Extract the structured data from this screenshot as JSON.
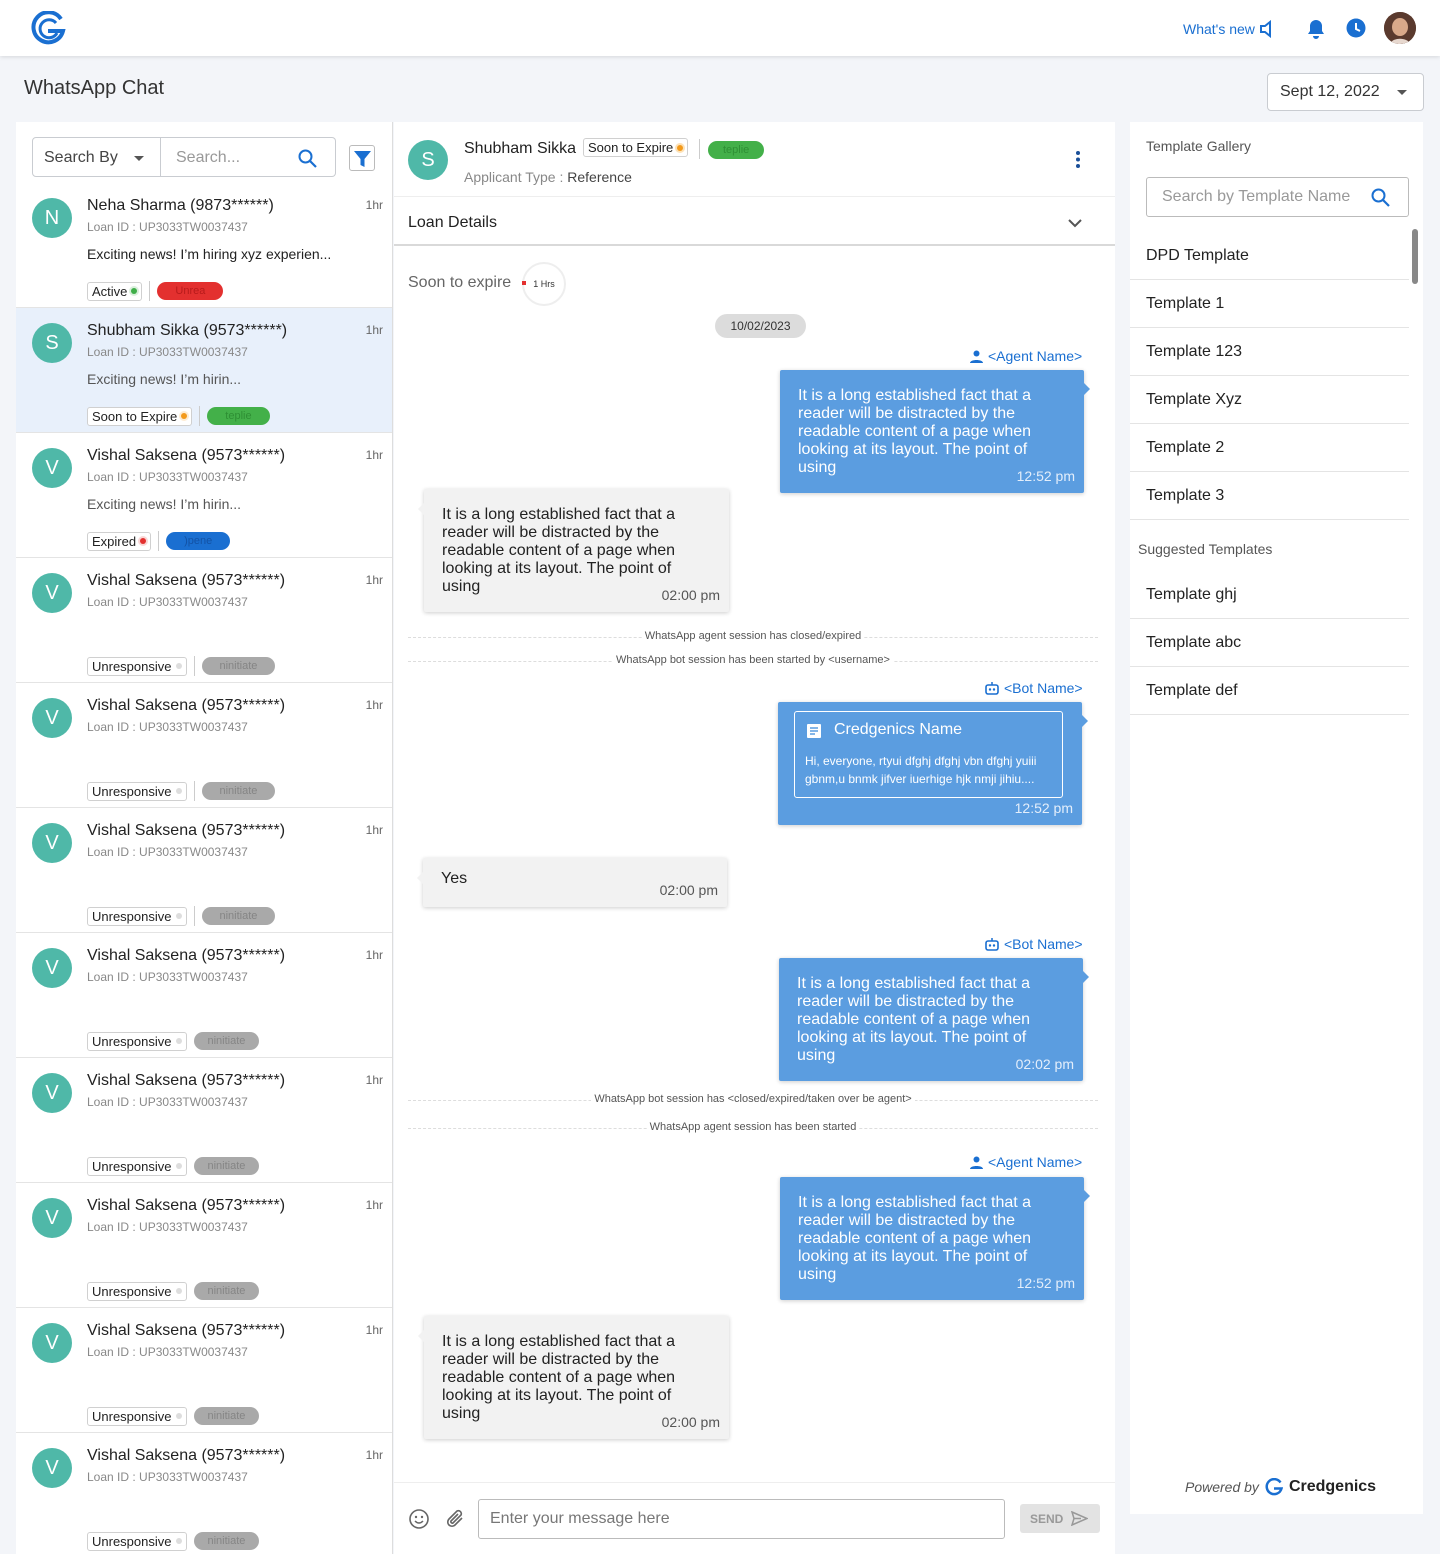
{
  "header": {
    "whats_new": "What's new"
  },
  "page": {
    "title": "WhatsApp Chat",
    "date": "Sept 12, 2022"
  },
  "search": {
    "by_label": "Search By",
    "placeholder": "Search..."
  },
  "colors": {
    "accent": "#1a6fd1",
    "teal": "#4fb8a8",
    "bubble_out": "#5b9de0"
  },
  "chats": [
    {
      "initial": "N",
      "name": "Neha Sharma (9873******)",
      "time": "1hr",
      "loan_label": "Loan ID :",
      "loan": "UP3033TW0037437",
      "message": "Exciting news! I’m hiring xyz experien...",
      "status": "Active",
      "status_color": "#3fae49",
      "pill": "Unrea",
      "pill_bg": "#e3302f",
      "pill_color": "#b81b1b"
    },
    {
      "initial": "S",
      "name": "Shubham Sikka (9573******)",
      "time": "1hr",
      "loan_label": "Loan ID :",
      "loan": "UP3033TW0037437",
      "message": "Exciting news! I’m hirin...",
      "status": "Soon to Expire",
      "status_color": "#f39a1b",
      "pill": "teplie",
      "pill_bg": "#43b049",
      "pill_color": "#2e8f34"
    },
    {
      "initial": "V",
      "name": "Vishal Saksena (9573******)",
      "time": "1hr",
      "loan_label": "Loan ID :",
      "loan": "UP3033TW0037437",
      "message": "Exciting news! I’m hirin...",
      "status": "Expired",
      "status_color": "#e3302f",
      "pill": ")pene",
      "pill_bg": "#1a6fd1",
      "pill_color": "#1252a5"
    },
    {
      "initial": "V",
      "name": "Vishal Saksena (9573******)",
      "time": "1hr",
      "loan_label": "Loan ID :",
      "loan": "UP3033TW0037437",
      "message": "",
      "status": "Unresponsive",
      "status_color": "#dddddd",
      "pill": "ninitiate",
      "pill_bg": "#a9a9a9",
      "pill_color": "#858585"
    },
    {
      "initial": "V",
      "name": "Vishal Saksena (9573******)",
      "time": "1hr",
      "loan_label": "Loan ID :",
      "loan": "UP3033TW0037437",
      "message": "",
      "status": "Unresponsive",
      "status_color": "#dddddd",
      "pill": "ninitiate",
      "pill_bg": "#a9a9a9",
      "pill_color": "#858585"
    },
    {
      "initial": "V",
      "name": "Vishal Saksena (9573******)",
      "time": "1hr",
      "loan_label": "Loan ID :",
      "loan": "UP3033TW0037437",
      "message": "",
      "status": "Unresponsive",
      "status_color": "#dddddd",
      "pill": "ninitiate",
      "pill_bg": "#a9a9a9",
      "pill_color": "#858585"
    },
    {
      "initial": "V",
      "name": "Vishal Saksena (9573******)",
      "time": "1hr",
      "loan_label": "Loan ID :",
      "loan": "UP3033TW0037437",
      "message": "",
      "status": "Unresponsive",
      "status_color": "#dddddd",
      "pill": "ninitiate",
      "pill_bg": "#a9a9a9",
      "pill_color": "#858585"
    },
    {
      "initial": "V",
      "name": "Vishal Saksena (9573******)",
      "time": "1hr",
      "loan_label": "Loan ID :",
      "loan": "UP3033TW0037437",
      "message": "",
      "status": "Unresponsive",
      "status_color": "#dddddd",
      "pill": "ninitiate",
      "pill_bg": "#a9a9a9",
      "pill_color": "#858585"
    },
    {
      "initial": "V",
      "name": "Vishal Saksena (9573******)",
      "time": "1hr",
      "loan_label": "Loan ID :",
      "loan": "UP3033TW0037437",
      "message": "",
      "status": "Unresponsive",
      "status_color": "#dddddd",
      "pill": "ninitiate",
      "pill_bg": "#a9a9a9",
      "pill_color": "#858585"
    },
    {
      "initial": "V",
      "name": "Vishal Saksena (9573******)",
      "time": "1hr",
      "loan_label": "Loan ID :",
      "loan": "UP3033TW0037437",
      "message": "",
      "status": "Unresponsive",
      "status_color": "#dddddd",
      "pill": "ninitiate",
      "pill_bg": "#a9a9a9",
      "pill_color": "#858585"
    },
    {
      "initial": "V",
      "name": "Vishal Saksena (9573******)",
      "time": "1hr",
      "loan_label": "Loan ID :",
      "loan": "UP3033TW0037437",
      "message": "",
      "status": "Unresponsive",
      "status_color": "#dddddd",
      "pill": "ninitiate",
      "pill_bg": "#a9a9a9",
      "pill_color": "#858585"
    }
  ],
  "conversation": {
    "initial": "S",
    "name": "Shubham Sikka",
    "status": "Soon to Expire",
    "pill": "teplie",
    "applicant_type_label": "Applicant Type :",
    "applicant_type": "Reference",
    "loan_details": "Loan Details",
    "soon_to_expire": "Soon to expire",
    "timer": "1 Hrs",
    "date": "10/02/2023",
    "agent_name": "<Agent Name>",
    "bot_name": "<Bot Name>",
    "long_text": "It is a long established fact that a reader will be distracted by the readable content of a page when looking at its layout. The point of using",
    "times": {
      "t1": "12:52 pm",
      "t2": "02:00 pm",
      "t3": "12:52 pm",
      "t4": "02:00 pm",
      "t5": "02:02 pm",
      "t6": "12:52 pm",
      "t7": "02:00 pm"
    },
    "sys1": "WhatsApp agent session has closed/expired",
    "sys2": "WhatsApp bot session has been started by <username>",
    "sys3": "WhatsApp bot session has <closed/expired/taken over be agent>",
    "sys4": "WhatsApp agent session has been started",
    "card_title": "Credgenics Name",
    "card_text": "Hi, everyone, rtyui dfghj dfghj vbn dfghj yuiii gbnm,u bnmk jifver iuerhige hjk nmji jihiu....",
    "yes": "Yes",
    "input_placeholder": "Enter your message here",
    "send": "SEND"
  },
  "templates": {
    "title": "Template Gallery",
    "search_placeholder": "Search by Template Name",
    "items": [
      "DPD Template",
      "Template 1",
      "Template 123",
      "Template Xyz",
      "Template 2",
      "Template 3"
    ],
    "suggested_title": "Suggested Templates",
    "suggested": [
      "Template ghj",
      "Template abc",
      "Template def"
    ],
    "powered_by": "Powered by",
    "brand": "Credgenics"
  }
}
